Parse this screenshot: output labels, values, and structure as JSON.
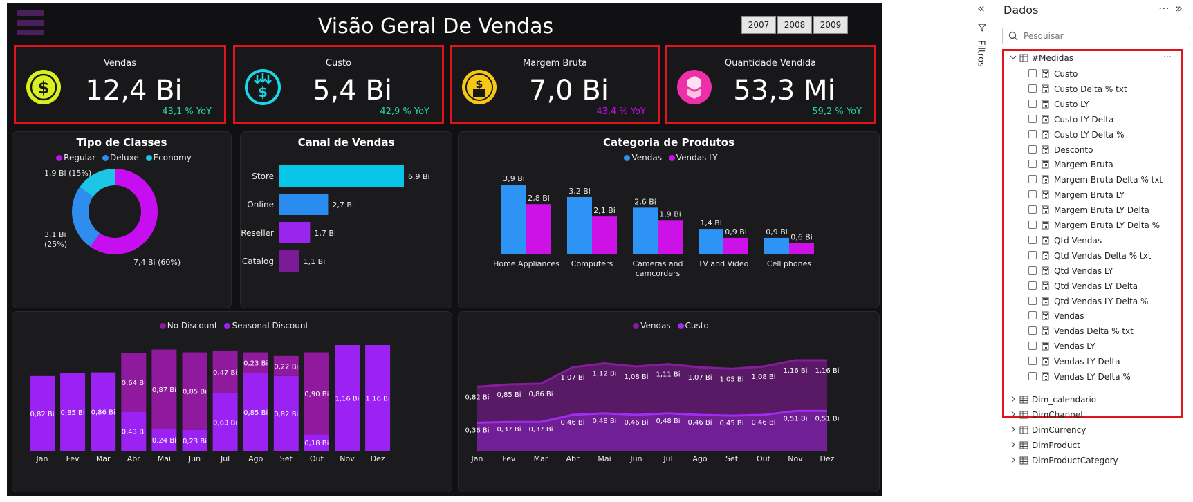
{
  "report": {
    "title": "Visão Geral De Vendas",
    "year_buttons": [
      "2007",
      "2008",
      "2009"
    ],
    "kpis": [
      {
        "title": "Vendas",
        "value": "12,4 Bi",
        "yoy": "43,1 % YoY",
        "yoy_color": "#2bd0a6",
        "icon": "dollar-coin-icon",
        "icon_color": "#d9f020"
      },
      {
        "title": "Custo",
        "value": "5,4 Bi",
        "yoy": "42,9 % YoY",
        "yoy_color": "#2bd0a6",
        "icon": "cost-down-icon",
        "icon_color": "#19d6ea"
      },
      {
        "title": "Margem Bruta",
        "value": "7,0 Bi",
        "yoy": "43,4 % YoY",
        "yoy_color": "#c90ce8",
        "icon": "margin-hand-icon",
        "icon_color": "#f5c818"
      },
      {
        "title": "Quantidade Vendida",
        "value": "53,3 Mi",
        "yoy": "59,2 % YoY",
        "yoy_color": "#2bd0a6",
        "icon": "boxes-icon",
        "icon_color": "#ef2fa8"
      }
    ],
    "panels": {
      "classes": {
        "title": "Tipo de Classes"
      },
      "canal": {
        "title": "Canal de Vendas"
      },
      "categoria": {
        "title": "Categoria de Produtos"
      }
    }
  },
  "chart_data": [
    {
      "type": "pie",
      "title": "Tipo de Classes",
      "donut": true,
      "legend": "top",
      "categories": [
        "Regular",
        "Deluxe",
        "Economy"
      ],
      "values": [
        7.4,
        3.1,
        1.9
      ],
      "data_labels": [
        "7,4 Bi (60%)",
        "3,1 Bi (25%)",
        "1,9 Bi (15%)"
      ],
      "colors": [
        "#c60ef0",
        "#2f8df0",
        "#1ec6e6"
      ]
    },
    {
      "type": "bar",
      "orientation": "horizontal",
      "title": "Canal de Vendas",
      "categories": [
        "Store",
        "Online",
        "Reseller",
        "Catalog"
      ],
      "values": [
        6.9,
        2.7,
        1.7,
        1.1
      ],
      "data_labels": [
        "6,9 Bi",
        "2,7 Bi",
        "1,7 Bi",
        "1,1 Bi"
      ],
      "colors": [
        "#08c4e6",
        "#2b8cf0",
        "#9a26ee",
        "#7a1a96"
      ]
    },
    {
      "type": "bar",
      "title": "Categoria de Produtos",
      "legend": "top",
      "categories": [
        "Home Appliances",
        "Computers",
        "Cameras and camcorders",
        "TV and Video",
        "Cell phones"
      ],
      "series": [
        {
          "name": "Vendas",
          "values": [
            3.9,
            3.2,
            2.6,
            1.4,
            0.9
          ],
          "labels": [
            "3,9 Bi",
            "3,2 Bi",
            "2,6 Bi",
            "1,4 Bi",
            "0,9 Bi"
          ],
          "color": "#2d93f5"
        },
        {
          "name": "Vendas LY",
          "values": [
            2.8,
            2.1,
            1.9,
            0.9,
            0.6
          ],
          "labels": [
            "2,8 Bi",
            "2,1 Bi",
            "1,9 Bi",
            "0,9 Bi",
            "0,6 Bi"
          ],
          "color": "#cc12e6"
        }
      ]
    },
    {
      "type": "bar",
      "stacked": true,
      "legend": "top",
      "categories": [
        "Jan",
        "Fev",
        "Mar",
        "Abr",
        "Mai",
        "Jun",
        "Jul",
        "Ago",
        "Set",
        "Out",
        "Nov",
        "Dez"
      ],
      "series": [
        {
          "name": "No Discount",
          "color": "#8f1a9e",
          "values": [
            0,
            0,
            0,
            0.64,
            0.87,
            0.85,
            0.47,
            0.23,
            0.22,
            0.9,
            0,
            0
          ],
          "labels": [
            "",
            "",
            "",
            "0,64 Bi",
            "0,87 Bi",
            "0,85 Bi",
            "0,47 Bi",
            "0,23 Bi",
            "0,22 Bi",
            "0,90 Bi",
            "",
            ""
          ]
        },
        {
          "name": "Seasonal Discount",
          "color": "#9b22f2",
          "values": [
            0.82,
            0.85,
            0.86,
            0.43,
            0.24,
            0.23,
            0.63,
            0.85,
            0.82,
            0.18,
            1.16,
            1.16
          ],
          "labels": [
            "0,82 Bi",
            "0,85 Bi",
            "0,86 Bi",
            "0,43 Bi",
            "0,24 Bi",
            "0,23 Bi",
            "0,63 Bi",
            "0,85 Bi",
            "0,82 Bi",
            "0,18 Bi",
            "1,16 Bi",
            "1,16 Bi"
          ]
        }
      ]
    },
    {
      "type": "area",
      "legend": "top",
      "categories": [
        "Jan",
        "Fev",
        "Mar",
        "Abr",
        "Mai",
        "Jun",
        "Jul",
        "Ago",
        "Set",
        "Out",
        "Nov",
        "Dez"
      ],
      "series": [
        {
          "name": "Vendas",
          "color": "#8a1aa0",
          "values": [
            0.82,
            0.85,
            0.86,
            1.07,
            1.12,
            1.08,
            1.11,
            1.07,
            1.05,
            1.08,
            1.16,
            1.16
          ],
          "labels": [
            "0,82 Bi",
            "0,85 Bi",
            "0,86 Bi",
            "1,07 Bi",
            "1,12 Bi",
            "1,08 Bi",
            "1,11 Bi",
            "1,07 Bi",
            "1,05 Bi",
            "1,08 Bi",
            "1,16 Bi",
            "1,16 Bi"
          ]
        },
        {
          "name": "Custo",
          "color": "#a12cf2",
          "values": [
            0.36,
            0.37,
            0.37,
            0.46,
            0.48,
            0.46,
            0.48,
            0.46,
            0.45,
            0.46,
            0.51,
            0.51
          ],
          "labels": [
            "0,36 Bi",
            "0,37 Bi",
            "0,37 Bi",
            "0,46 Bi",
            "0,48 Bi",
            "0,46 Bi",
            "0,48 Bi",
            "0,46 Bi",
            "0,45 Bi",
            "0,46 Bi",
            "0,51 Bi",
            "0,51 Bi"
          ]
        }
      ]
    }
  ],
  "sidebar": {
    "filters_label": "Filtros",
    "title": "Dados",
    "search_placeholder": "Pesquisar",
    "medidas_table": "#Medidas",
    "measures": [
      "Custo",
      "Custo Delta % txt",
      "Custo LY",
      "Custo LY Delta",
      "Custo LY Delta %",
      "Desconto",
      "Margem Bruta",
      "Margem Bruta Delta % txt",
      "Margem Bruta LY",
      "Margem Bruta LY Delta",
      "Margem Bruta LY Delta %",
      "Qtd Vendas",
      "Qtd Vendas Delta % txt",
      "Qtd Vendas LY",
      "Qtd Vendas LY Delta",
      "Qtd Vendas LY Delta %",
      "Vendas",
      "Vendas Delta % txt",
      "Vendas LY",
      "Vendas LY Delta",
      "Vendas LY Delta %"
    ],
    "tables": [
      "Dim_calendario",
      "DimChannel",
      "DimCurrency",
      "DimProduct",
      "DimProductCategory"
    ]
  }
}
